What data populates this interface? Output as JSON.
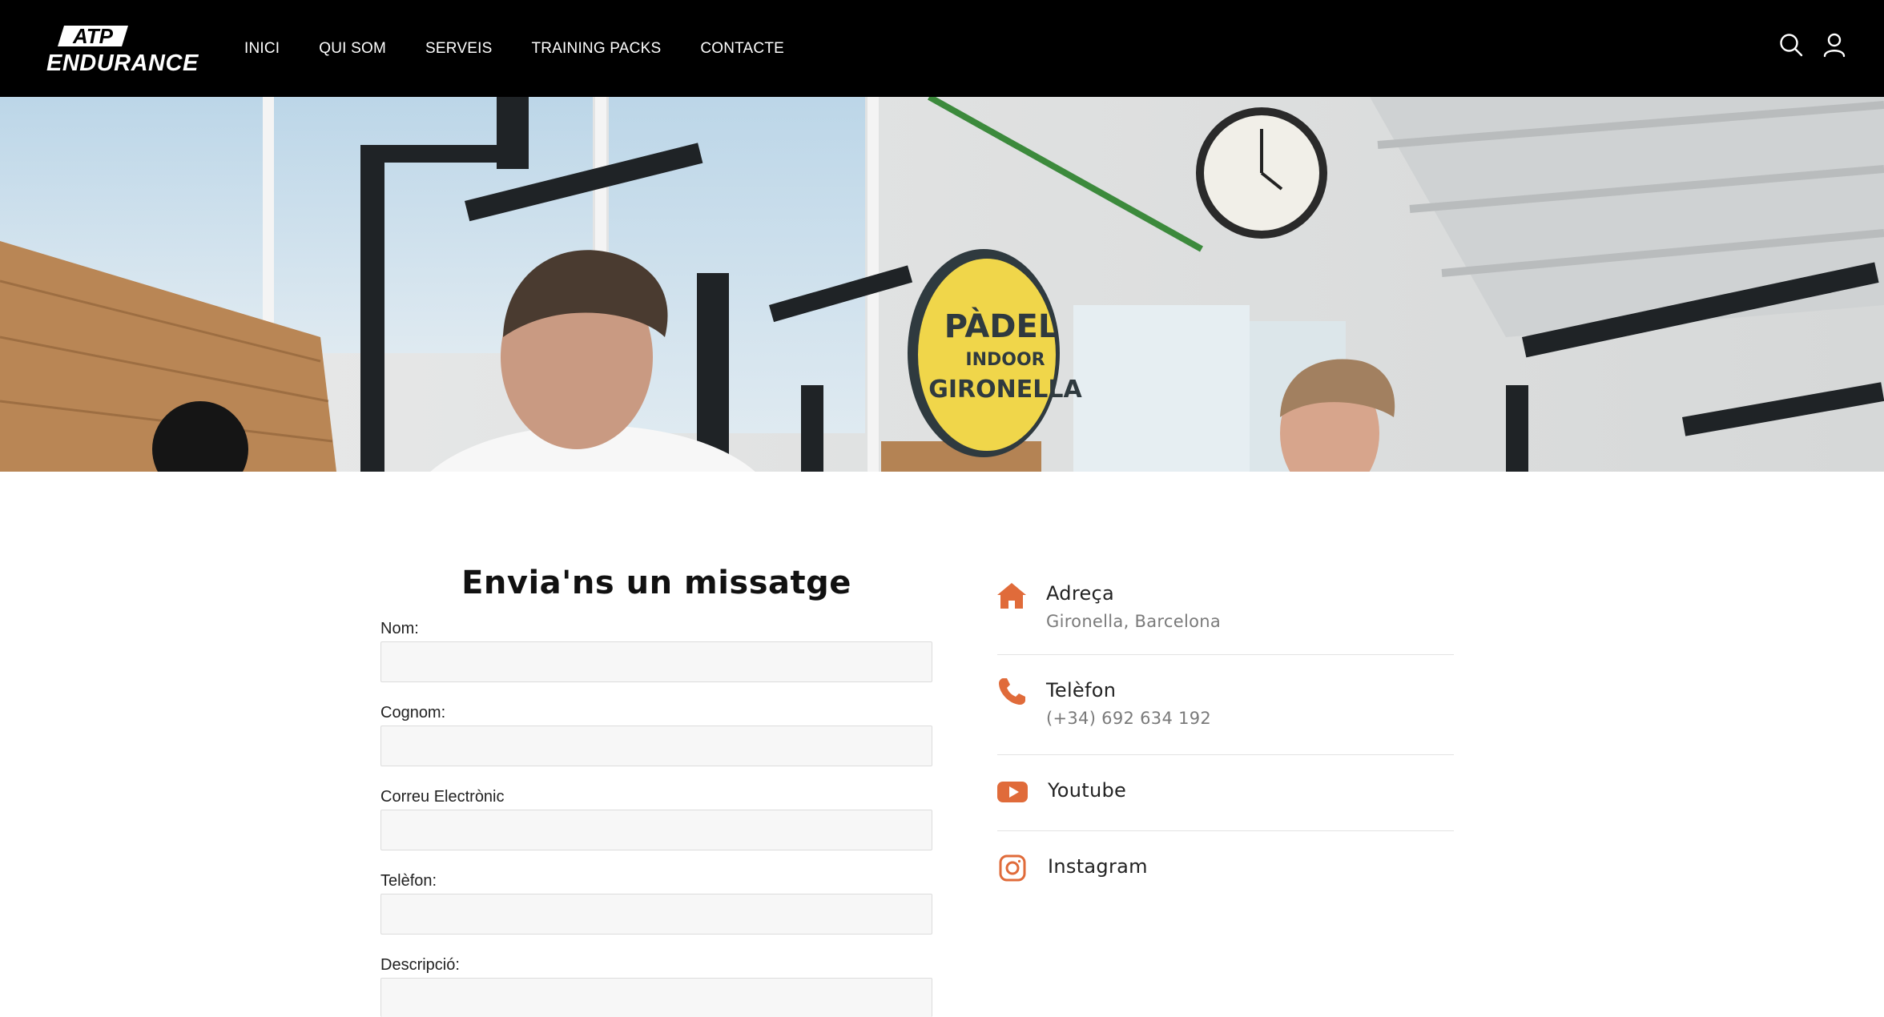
{
  "header": {
    "logo_line1": "ATP",
    "logo_line2": "ENDURANCE",
    "nav": [
      "INICI",
      "QUI SOM",
      "SERVEIS",
      "TRAINING PACKS",
      "CONTACTE"
    ]
  },
  "hero": {
    "sign_line1": "PÀDEL",
    "sign_line2": "INDOOR",
    "sign_line3": "GIRONELLA"
  },
  "form": {
    "title": "Envia'ns un missatge",
    "fields": [
      {
        "label": "Nom:",
        "value": ""
      },
      {
        "label": "Cognom:",
        "value": ""
      },
      {
        "label": "Correu Electrònic",
        "value": ""
      },
      {
        "label": "Telèfon:",
        "value": ""
      },
      {
        "label": "Descripció:",
        "value": ""
      }
    ]
  },
  "contact": {
    "address_title": "Adreça",
    "address_value": "Gironella, Barcelona",
    "phone_title": "Telèfon",
    "phone_value": "(+34) 692 634 192",
    "youtube": "Youtube",
    "instagram": "Instagram"
  },
  "colors": {
    "accent": "#e06b3a",
    "header_bg": "#000000",
    "input_bg": "#f7f7f7"
  },
  "icons": [
    "search-icon",
    "user-icon",
    "home-icon",
    "phone-icon",
    "youtube-icon",
    "instagram-icon"
  ]
}
